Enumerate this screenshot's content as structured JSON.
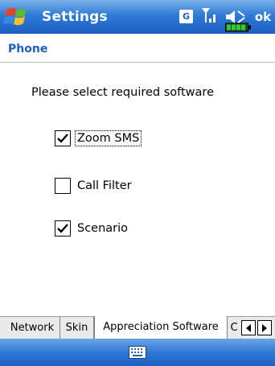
{
  "titlebar": {
    "title": "Settings",
    "network_badge": "G",
    "ok_label": "ok",
    "icons": [
      "windows-flag-icon",
      "signal-icon",
      "volume-icon",
      "battery-icon"
    ]
  },
  "section": {
    "title": "Phone"
  },
  "content": {
    "prompt": "Please select required software",
    "options": [
      {
        "label": "Zoom SMS",
        "checked": true,
        "focused": true
      },
      {
        "label": "Call Filter",
        "checked": false,
        "focused": false
      },
      {
        "label": "Scenario",
        "checked": true,
        "focused": false
      }
    ]
  },
  "tabs": [
    {
      "label": "Network",
      "active": false
    },
    {
      "label": "Skin",
      "active": false
    },
    {
      "label": "Appreciation Software",
      "active": true
    },
    {
      "label": "C",
      "active": false
    }
  ],
  "menubar": {
    "icon": "keyboard-icon"
  },
  "colors": {
    "titlebar_blue": "#2f7ad6",
    "header_text": "#1d5fbf",
    "battery_green": "#33cc33"
  }
}
